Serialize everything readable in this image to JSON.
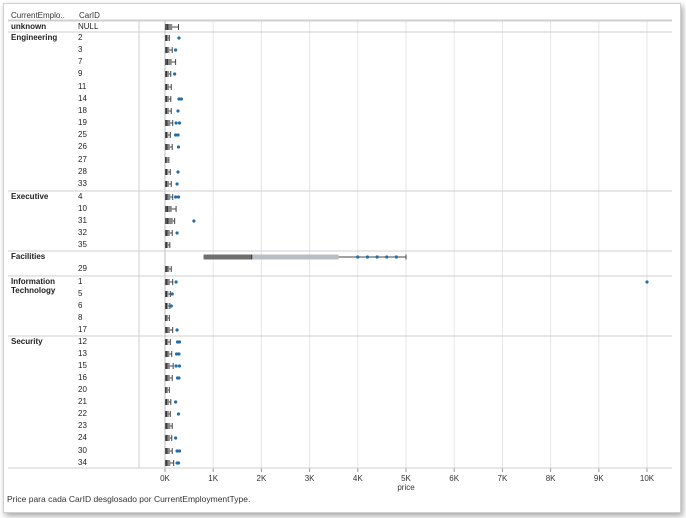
{
  "header": {
    "col1": "CurrentEmplo..",
    "col2": "CarID"
  },
  "caption": "Price para cada CarID desglosado por CurrentEmploymentType.",
  "colors": {
    "box_dark": "#555555",
    "box_light": "#b9bec4",
    "point": "#1f6fad",
    "grid": "#e6e6e6",
    "separator": "#cfcfcf"
  },
  "chart_data": {
    "type": "box",
    "xlabel": "price",
    "x_ticks": [
      "0K",
      "1K",
      "2K",
      "3K",
      "4K",
      "5K",
      "6K",
      "7K",
      "8K",
      "9K",
      "10K"
    ],
    "xlim": [
      0,
      10000
    ],
    "groups": [
      {
        "name": "unknown",
        "rows": [
          {
            "car": "NULL",
            "q1": 0,
            "median": 60,
            "q3": 150,
            "max": 280,
            "outliers": []
          }
        ]
      },
      {
        "name": "Engineering",
        "rows": [
          {
            "car": "2",
            "q1": 0,
            "median": 30,
            "q3": 70,
            "max": 90,
            "outliers": [
              290
            ]
          },
          {
            "car": "3",
            "q1": 0,
            "median": 40,
            "q3": 90,
            "max": 150,
            "outliers": [
              220
            ]
          },
          {
            "car": "7",
            "q1": 0,
            "median": 50,
            "q3": 140,
            "max": 220,
            "outliers": []
          },
          {
            "car": "9",
            "q1": 0,
            "median": 30,
            "q3": 80,
            "max": 120,
            "outliers": [
              200
            ]
          },
          {
            "car": "11",
            "q1": 0,
            "median": 30,
            "q3": 80,
            "max": 130,
            "outliers": []
          },
          {
            "car": "14",
            "q1": 0,
            "median": 30,
            "q3": 80,
            "max": 120,
            "outliers": [
              290,
              340
            ]
          },
          {
            "car": "18",
            "q1": 0,
            "median": 30,
            "q3": 80,
            "max": 130,
            "outliers": [
              270
            ]
          },
          {
            "car": "19",
            "q1": 0,
            "median": 40,
            "q3": 110,
            "max": 160,
            "outliers": [
              230,
              300
            ]
          },
          {
            "car": "25",
            "q1": 0,
            "median": 30,
            "q3": 70,
            "max": 110,
            "outliers": [
              220,
              270
            ]
          },
          {
            "car": "26",
            "q1": 0,
            "median": 40,
            "q3": 100,
            "max": 150,
            "outliers": [
              280
            ]
          },
          {
            "car": "27",
            "q1": 0,
            "median": 20,
            "q3": 60,
            "max": 80,
            "outliers": []
          },
          {
            "car": "28",
            "q1": 0,
            "median": 30,
            "q3": 70,
            "max": 110,
            "outliers": [
              270
            ]
          },
          {
            "car": "33",
            "q1": 0,
            "median": 30,
            "q3": 80,
            "max": 130,
            "outliers": [
              250
            ]
          }
        ]
      },
      {
        "name": "Executive",
        "rows": [
          {
            "car": "4",
            "q1": 0,
            "median": 40,
            "q3": 110,
            "max": 160,
            "outliers": [
              220,
              280
            ]
          },
          {
            "car": "10",
            "q1": 0,
            "median": 50,
            "q3": 140,
            "max": 230,
            "outliers": []
          },
          {
            "car": "31",
            "q1": 0,
            "median": 60,
            "q3": 160,
            "max": 200,
            "outliers": [
              600
            ]
          },
          {
            "car": "32",
            "q1": 0,
            "median": 40,
            "q3": 100,
            "max": 150,
            "outliers": [
              250
            ]
          },
          {
            "car": "35",
            "q1": 0,
            "median": 30,
            "q3": 70,
            "max": 100,
            "outliers": []
          }
        ]
      },
      {
        "name": "Facilities",
        "rows": [
          {
            "car": "",
            "q1": 800,
            "median": 1800,
            "q3": 3600,
            "max": 5000,
            "outliers": [
              4000,
              4200,
              4400,
              4600,
              4800
            ]
          },
          {
            "car": "29",
            "q1": 0,
            "median": 40,
            "q3": 90,
            "max": 130,
            "outliers": []
          }
        ]
      },
      {
        "name": "Information Technology",
        "rows": [
          {
            "car": "1",
            "q1": 0,
            "median": 40,
            "q3": 100,
            "max": 160,
            "outliers": [
              230,
              10000
            ]
          },
          {
            "car": "5",
            "q1": 0,
            "median": 30,
            "q3": 70,
            "max": 110,
            "outliers": [
              150
            ]
          },
          {
            "car": "6",
            "q1": 0,
            "median": 30,
            "q3": 70,
            "max": 100,
            "outliers": [
              130
            ]
          },
          {
            "car": "8",
            "q1": 0,
            "median": 20,
            "q3": 60,
            "max": 90,
            "outliers": []
          },
          {
            "car": "17",
            "q1": 0,
            "median": 40,
            "q3": 100,
            "max": 160,
            "outliers": [
              250
            ]
          }
        ]
      },
      {
        "name": "Security",
        "rows": [
          {
            "car": "12",
            "q1": 0,
            "median": 30,
            "q3": 70,
            "max": 110,
            "outliers": [
              260,
              300
            ]
          },
          {
            "car": "13",
            "q1": 0,
            "median": 40,
            "q3": 90,
            "max": 140,
            "outliers": [
              240,
              290
            ]
          },
          {
            "car": "15",
            "q1": 0,
            "median": 40,
            "q3": 100,
            "max": 170,
            "outliers": [
              230,
              300
            ]
          },
          {
            "car": "16",
            "q1": 0,
            "median": 40,
            "q3": 100,
            "max": 150,
            "outliers": [
              260,
              290
            ]
          },
          {
            "car": "20",
            "q1": 0,
            "median": 20,
            "q3": 60,
            "max": 90,
            "outliers": []
          },
          {
            "car": "21",
            "q1": 0,
            "median": 30,
            "q3": 80,
            "max": 120,
            "outliers": [
              220
            ]
          },
          {
            "car": "22",
            "q1": 0,
            "median": 30,
            "q3": 80,
            "max": 110,
            "outliers": [
              280
            ]
          },
          {
            "car": "23",
            "q1": 0,
            "median": 40,
            "q3": 110,
            "max": 150,
            "outliers": []
          },
          {
            "car": "24",
            "q1": 0,
            "median": 40,
            "q3": 100,
            "max": 140,
            "outliers": [
              220
            ]
          },
          {
            "car": "30",
            "q1": 0,
            "median": 40,
            "q3": 100,
            "max": 150,
            "outliers": [
              250,
              300
            ]
          },
          {
            "car": "34",
            "q1": 0,
            "median": 40,
            "q3": 110,
            "max": 180,
            "outliers": [
              250,
              280
            ]
          }
        ]
      }
    ]
  }
}
